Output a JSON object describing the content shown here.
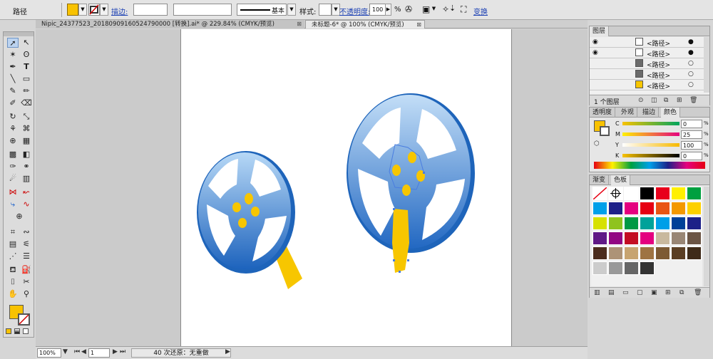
{
  "control_bar": {
    "selection_label": "路径",
    "fill_color": "#f8c200",
    "stroke_label": "描边:",
    "stroke_weight_value": "",
    "brush_style_label": "基本",
    "style_label": "样式:",
    "opacity_label": "不透明度:",
    "opacity_value": "100",
    "opacity_unit": "%",
    "transform_label": "变换"
  },
  "tabs": [
    {
      "label": "Nipic_24377523_20180909160524790000 [转换].ai* @ 229.84% (CMYK/预览)",
      "close": "⊠"
    },
    {
      "label": "未标题-6* @ 100% (CMYK/预览)",
      "close": "⊠"
    }
  ],
  "status_bar": {
    "zoom": "100%",
    "artboard_number": "1",
    "status_text": "40 次还原：无重做"
  },
  "layers_panel": {
    "tab_label": "图层",
    "rows": [
      {
        "label": "<路径>",
        "visible": true
      },
      {
        "label": "<路径>",
        "visible": true
      },
      {
        "label": "<路径>",
        "visible": false
      },
      {
        "label": "<路径>",
        "visible": false
      },
      {
        "label": "<路径>",
        "visible": false
      }
    ],
    "footer_label": "1 个图层"
  },
  "color_panel": {
    "tabs": [
      "透明度",
      "外观",
      "描边",
      "颜色"
    ],
    "active_tab": "颜色",
    "channels": [
      {
        "name": "C",
        "value": "0"
      },
      {
        "name": "M",
        "value": "25"
      },
      {
        "name": "Y",
        "value": "100"
      },
      {
        "name": "K",
        "value": "0"
      }
    ],
    "unit": "%",
    "fill_color": "#f8c200"
  },
  "swatches_panel": {
    "tabs": [
      "渐变",
      "色板"
    ],
    "active_tab": "色板",
    "colors": [
      "#000000",
      "#e8001c",
      "#fff000",
      "#00a040",
      "#00a0e9",
      "#1d2088",
      "#e4007f",
      "#e60012",
      "#e95513",
      "#f39800",
      "#fdd000",
      "#d7e100",
      "#8fc31f",
      "#009944",
      "#00a29a",
      "#009fe8",
      "#004098",
      "#1d2088",
      "#601986",
      "#920783",
      "#c30d23",
      "#e4007f",
      "#c9b99e",
      "#998675",
      "#6b5545",
      "#4c2d1e",
      "#ad9377",
      "#c7a470",
      "#9e7342",
      "#7d5a33",
      "#5c3f24",
      "#3f2b19",
      "#cccccc",
      "#999999",
      "#666666",
      "#333333"
    ]
  },
  "canvas": {
    "reel_color_light": "#a9cdf1",
    "reel_color_dark": "#1c5fb8",
    "handle_color": "#f7c600"
  }
}
